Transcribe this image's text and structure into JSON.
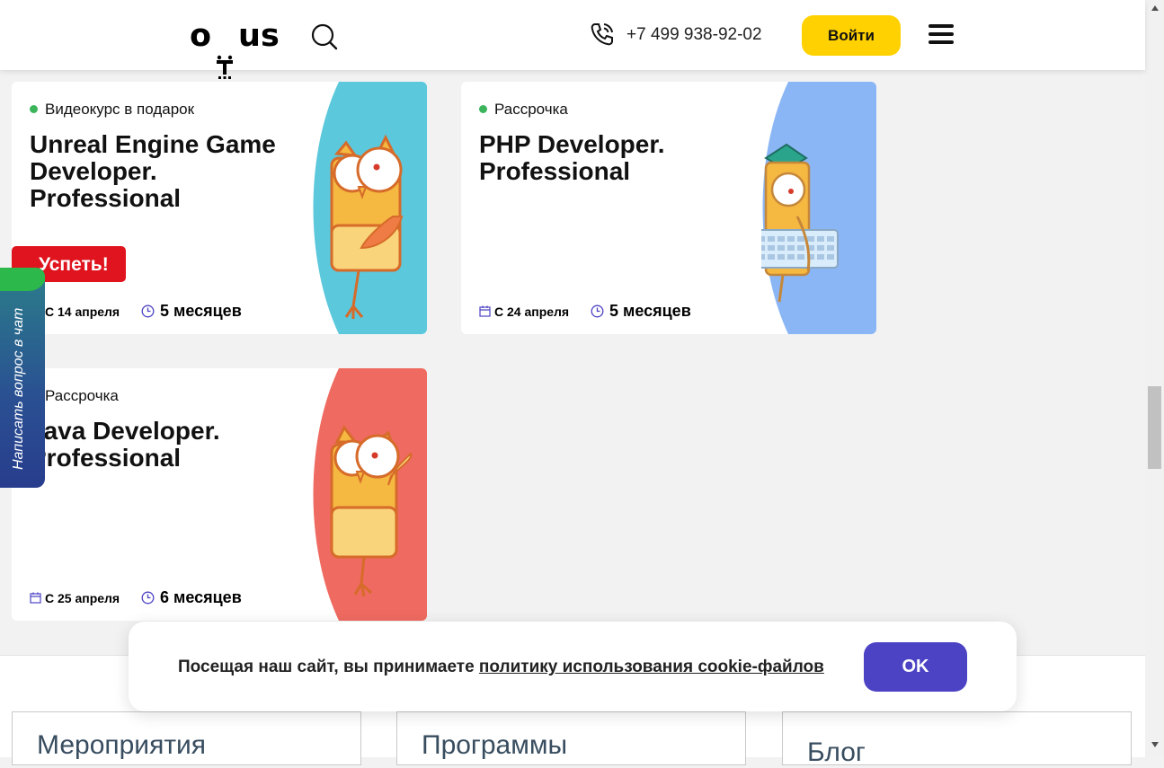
{
  "header": {
    "logo_text": "otus",
    "phone": "+7 499 938-92-02",
    "login_label": "Войти"
  },
  "courses": [
    {
      "badge": "Видеокурс в подарок",
      "title": "Unreal Engine Game Developer. Professional",
      "promo": "Успеть!",
      "start": "С 14 апреля",
      "duration": "5 месяцев",
      "art_color": "#5bc8dc"
    },
    {
      "badge": "Рассрочка",
      "title": "PHP Developer. Professional",
      "start": "С 24 апреля",
      "duration": "5 месяцев",
      "art_color": "#8ab6f5"
    },
    {
      "badge": "Рассрочка",
      "title": "Java Developer. Professional",
      "start": "С 25 апреля",
      "duration": "6 месяцев",
      "art_color": "#ef6a60"
    }
  ],
  "chat": {
    "label": "Написать вопрос в чат"
  },
  "cookie": {
    "text": "Посещая наш сайт, вы принимаете ",
    "link": "политику использования cookie-файлов",
    "ok_label": "OK"
  },
  "footer": {
    "sections": [
      "Мероприятия",
      "Программы",
      "Блог"
    ]
  },
  "colors": {
    "accent_yellow": "#ffd100",
    "ok_button": "#4c43c4",
    "promo_red": "#e0141e",
    "status_green": "#3cb45c"
  }
}
